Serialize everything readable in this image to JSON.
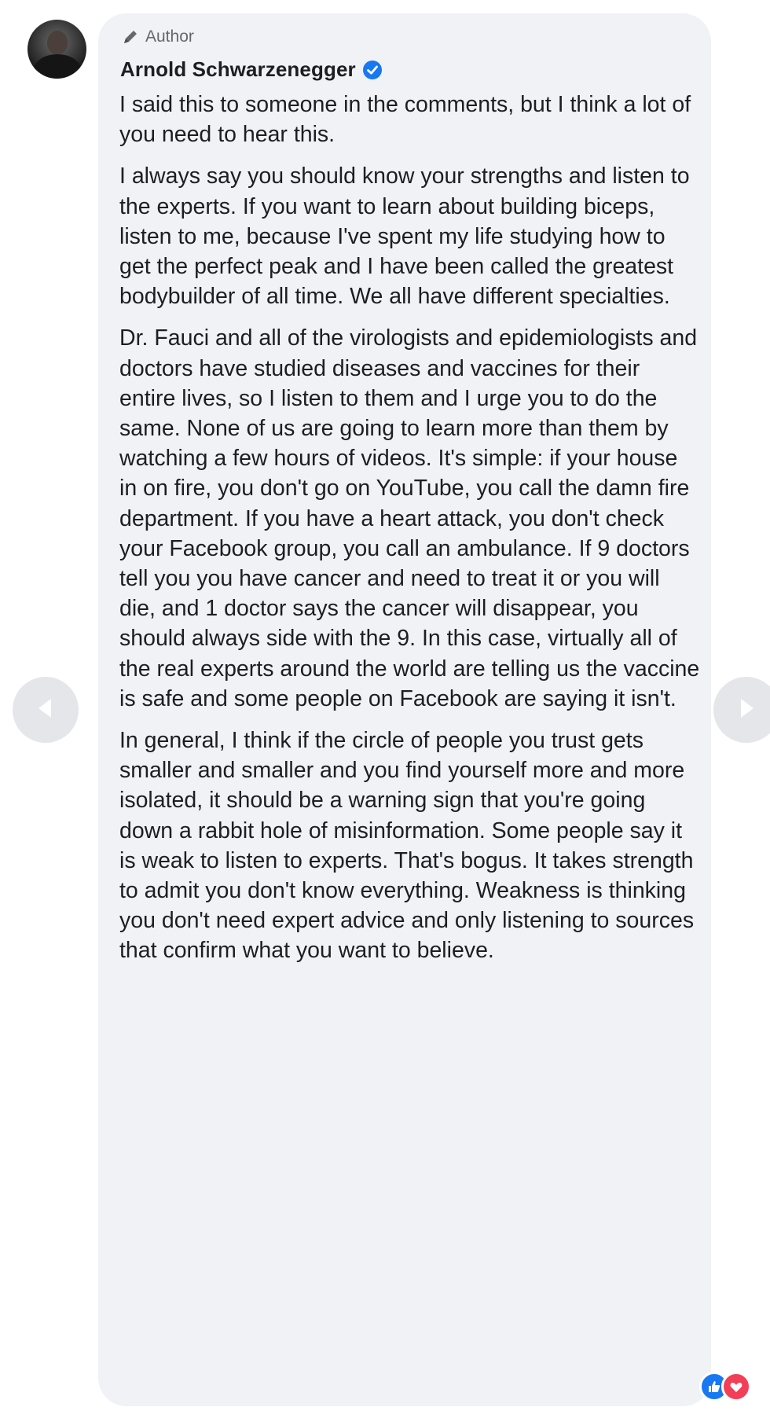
{
  "post": {
    "author_badge": "Author",
    "name": "Arnold Schwarzenegger",
    "paragraphs": [
      "I said this to someone in the comments, but I think a lot of you need to hear this.",
      "I always say you should know your strengths and listen to the experts. If you want to learn about building biceps, listen to me, because I've spent my life studying how to get the perfect peak and I have been called the greatest bodybuilder of all time. We all have different specialties.",
      "Dr. Fauci and all of the virologists and epidemiologists and doctors have studied diseases and vaccines for their entire lives, so I listen to them and I urge you to do the same. None of us are going to learn more than them by watching a few hours of videos. It's simple: if your house in on fire, you don't go on YouTube, you call the damn fire department. If you have a heart attack, you don't check your Facebook group, you call an ambulance. If 9 doctors tell you you have cancer and need to treat it or you will die, and 1 doctor says the cancer will disappear, you should always side with the 9. In this case, virtually all of the real experts around the world are telling us the vaccine is safe and some people on Facebook are saying it isn't.",
      "In general, I think if the circle of people you trust gets smaller and smaller and you find yourself more and more isolated, it should be a warning sign that you're going down a rabbit hole of misinformation. Some people say it is weak to listen to experts. That's bogus. It takes strength to admit you don't know everything. Weakness is thinking you don't need expert advice and only listening to sources that confirm what you want to believe."
    ]
  },
  "icons": {
    "badge": "pencil-icon",
    "verified": "verified-badge-icon",
    "prev": "chevron-left-icon",
    "next": "chevron-right-icon",
    "reactions": [
      "like-reaction-icon",
      "love-reaction-icon"
    ]
  },
  "colors": {
    "bubble_bg": "#f0f2f5",
    "verified_blue": "#1877f2",
    "secondary_text": "#65676b",
    "nav_button": "#e4e6ea"
  }
}
